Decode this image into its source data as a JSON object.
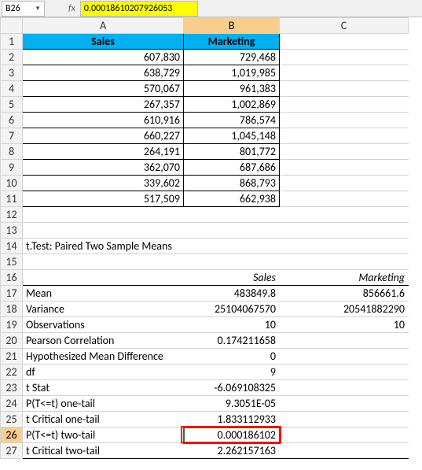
{
  "namebox": "B26",
  "formula": "0.00018610207926053",
  "columns": [
    "A",
    "B",
    "C"
  ],
  "headers": {
    "a": "Sales",
    "b": "Marketing"
  },
  "table": [
    {
      "a": "607,830",
      "b": "729,468"
    },
    {
      "a": "638,729",
      "b": "1,019,985"
    },
    {
      "a": "570,067",
      "b": "961,383"
    },
    {
      "a": "267,357",
      "b": "1,002,869"
    },
    {
      "a": "610,916",
      "b": "786,574"
    },
    {
      "a": "660,227",
      "b": "1,045,148"
    },
    {
      "a": "264,191",
      "b": "801,772"
    },
    {
      "a": "362,070",
      "b": "687,686"
    },
    {
      "a": "339,602",
      "b": "868,793"
    },
    {
      "a": "517,509",
      "b": "662,938"
    }
  ],
  "ttest_title": "t.Test: Paired Two Sample Means",
  "stats_headers": {
    "b": "Sales",
    "c": "Marketing"
  },
  "stats": [
    {
      "label": "Mean",
      "b": "483849.8",
      "c": "856661.6"
    },
    {
      "label": "Variance",
      "b": "25104067570",
      "c": "20541882290"
    },
    {
      "label": "Observations",
      "b": "10",
      "c": "10"
    },
    {
      "label": "Pearson Correlation",
      "b": "0.174211658",
      "c": ""
    },
    {
      "label": "Hypothesized Mean Difference",
      "b": "0",
      "c": ""
    },
    {
      "label": "df",
      "b": "9",
      "c": ""
    },
    {
      "label": "t Stat",
      "b": "-6.069108325",
      "c": ""
    },
    {
      "label": "P(T<=t) one-tail",
      "b": "9.3051E-05",
      "c": ""
    },
    {
      "label": "t Critical one-tail",
      "b": "1.833112933",
      "c": ""
    },
    {
      "label": "P(T<=t) two-tail",
      "b": "0.000186102",
      "c": ""
    },
    {
      "label": "t Critical two-tail",
      "b": "2.262157163",
      "c": ""
    }
  ],
  "chart_data": {
    "type": "table",
    "title": "t.Test: Paired Two Sample Means",
    "series": [
      {
        "name": "Sales",
        "values": [
          607830,
          638729,
          570067,
          267357,
          610916,
          660227,
          264191,
          362070,
          339602,
          517509
        ]
      },
      {
        "name": "Marketing",
        "values": [
          729468,
          1019985,
          961383,
          1002869,
          786574,
          1045148,
          801772,
          687686,
          868793,
          662938
        ]
      }
    ],
    "stats": {
      "Mean": {
        "Sales": 483849.8,
        "Marketing": 856661.6
      },
      "Variance": {
        "Sales": 25104067570,
        "Marketing": 20541882290
      },
      "Observations": {
        "Sales": 10,
        "Marketing": 10
      },
      "Pearson Correlation": 0.174211658,
      "Hypothesized Mean Difference": 0,
      "df": 9,
      "t Stat": -6.069108325,
      "P(T<=t) one-tail": 9.3051e-05,
      "t Critical one-tail": 1.833112933,
      "P(T<=t) two-tail": 0.000186102,
      "t Critical two-tail": 2.262157163
    }
  }
}
